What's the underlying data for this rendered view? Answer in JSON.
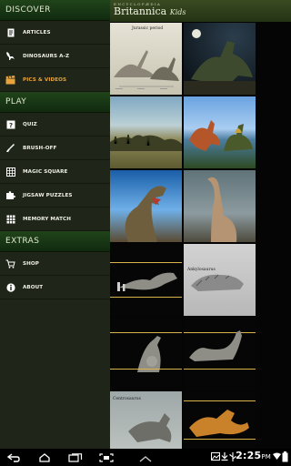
{
  "drawer": {
    "sections": [
      {
        "title": "DISCOVER",
        "items": [
          {
            "label": "ARTICLES",
            "icon": "article-icon",
            "active": false
          },
          {
            "label": "DINOSAURS A-Z",
            "icon": "dinosaur-icon",
            "active": false
          },
          {
            "label": "PICS & VIDEOS",
            "icon": "clapperboard-icon",
            "active": true
          }
        ]
      },
      {
        "title": "PLAY",
        "items": [
          {
            "label": "QUIZ",
            "icon": "quiz-icon",
            "active": false
          },
          {
            "label": "BRUSH-OFF",
            "icon": "brush-icon",
            "active": false
          },
          {
            "label": "MAGIC SQUARE",
            "icon": "magic-square-icon",
            "active": false
          },
          {
            "label": "JIGSAW PUZZLES",
            "icon": "puzzle-icon",
            "active": false
          },
          {
            "label": "MEMORY MATCH",
            "icon": "memory-grid-icon",
            "active": false
          }
        ]
      },
      {
        "title": "EXTRAS",
        "items": [
          {
            "label": "SHOP",
            "icon": "cart-icon",
            "active": false
          },
          {
            "label": "ABOUT",
            "icon": "info-icon",
            "active": false
          }
        ]
      }
    ]
  },
  "brand": {
    "line1": "ENCYCLOPÆDIA",
    "name": "Britannica",
    "suffix": "Kids"
  },
  "gallery": {
    "tile_labels": {
      "t1": "Jurassic period",
      "t8": "Ankylosaurus",
      "t11": "Centrosaurus"
    }
  },
  "status_bar": {
    "time": "2:25",
    "ampm": "PM"
  },
  "colors": {
    "active_item": "#e8a43a",
    "section_header": "#1a3a16",
    "drawer_bg": "#20251a"
  }
}
